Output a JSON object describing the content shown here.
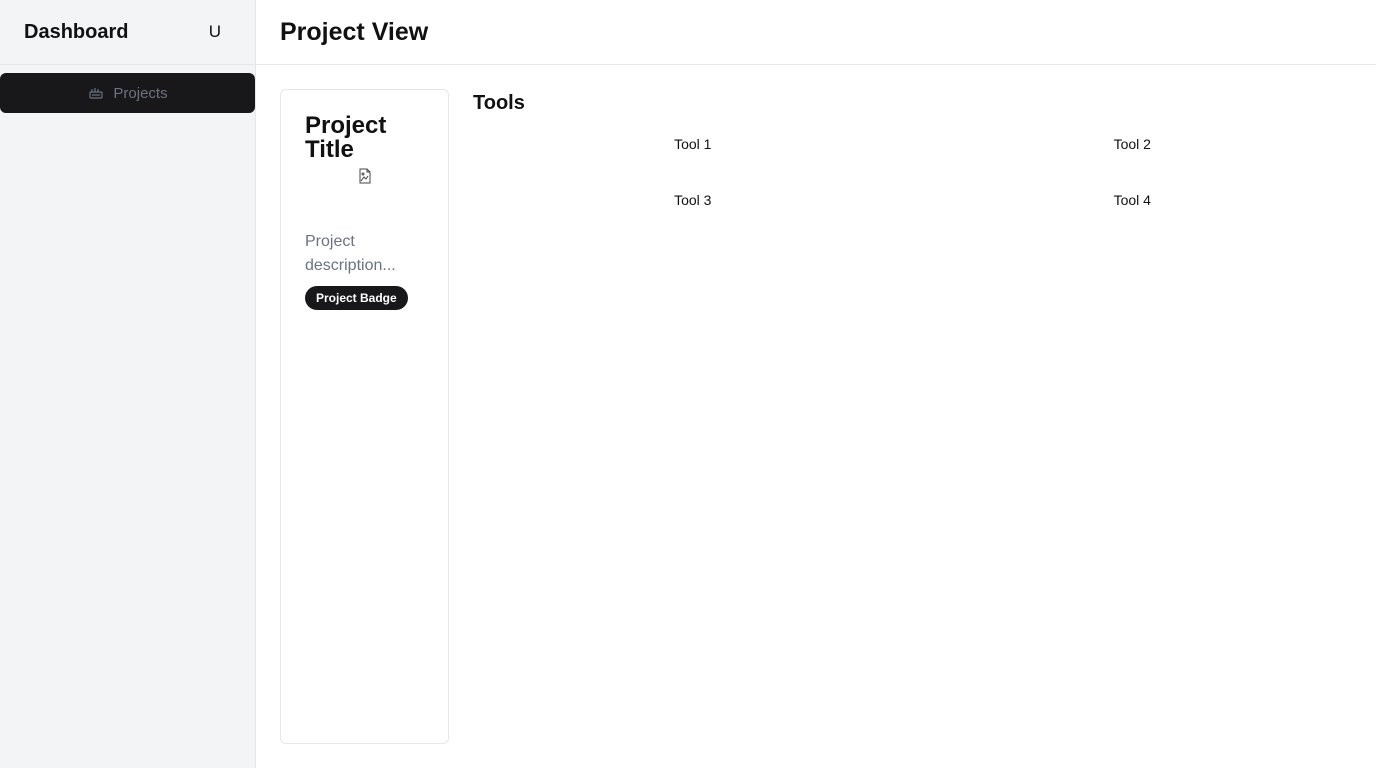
{
  "sidebar": {
    "brand": "Dashboard",
    "avatar_initial": "U",
    "nav_items": [
      {
        "label": "Projects",
        "icon": "projects-icon"
      }
    ]
  },
  "header": {
    "title": "Project View"
  },
  "project": {
    "title": "Project Title",
    "image_icon": "broken-image-icon",
    "description": "Project description...",
    "badge": "Project Badge"
  },
  "tools": {
    "title": "Tools",
    "items": [
      "Tool 1",
      "Tool 2",
      "Tool 3",
      "Tool 4"
    ]
  },
  "colors": {
    "sidebar_bg": "#f3f4f6",
    "active_nav_bg": "#18181b",
    "muted_text": "#6b7280",
    "border": "#e5e7eb"
  }
}
